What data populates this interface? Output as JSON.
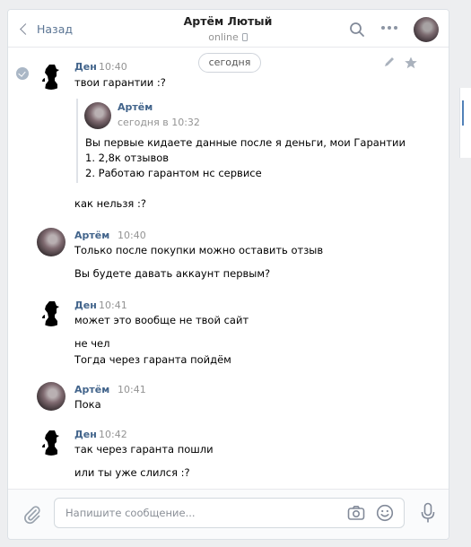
{
  "header": {
    "back_label": "Назад",
    "title": "Артём Лютый",
    "status": "online"
  },
  "date_pill": "сегодня",
  "messages": [
    {
      "author": "Ден",
      "time": "10:40",
      "lines": [
        "твои гарантии :?",
        "как нельзя :?"
      ],
      "quote": {
        "author": "Артём",
        "time": "сегодня в 10:32",
        "lines": [
          "Вы первые кидаете данные после я деньги, мои Гарантии",
          "1. 2,8к отзывов",
          "2. Работаю гарантом нс сервисе"
        ]
      }
    },
    {
      "author": "Артём",
      "time": "10:40",
      "lines": [
        "Только после покупки можно оставить отзыв",
        "Вы будете давать аккаунт первым?"
      ]
    },
    {
      "author": "Ден",
      "time": "10:41",
      "lines": [
        "может это вообще не твой сайт",
        "не чел",
        "Тогда через гаранта пойдём"
      ]
    },
    {
      "author": "Артём",
      "time": "10:41",
      "lines": [
        "Пока"
      ]
    },
    {
      "author": "Ден",
      "time": "10:42",
      "lines": [
        "так через гаранта пошли",
        "или ты уже слился :?"
      ]
    }
  ],
  "composer": {
    "placeholder": "Напишите сообщение..."
  },
  "colors": {
    "link_blue": "#42648b",
    "accent": "#5181b8"
  }
}
